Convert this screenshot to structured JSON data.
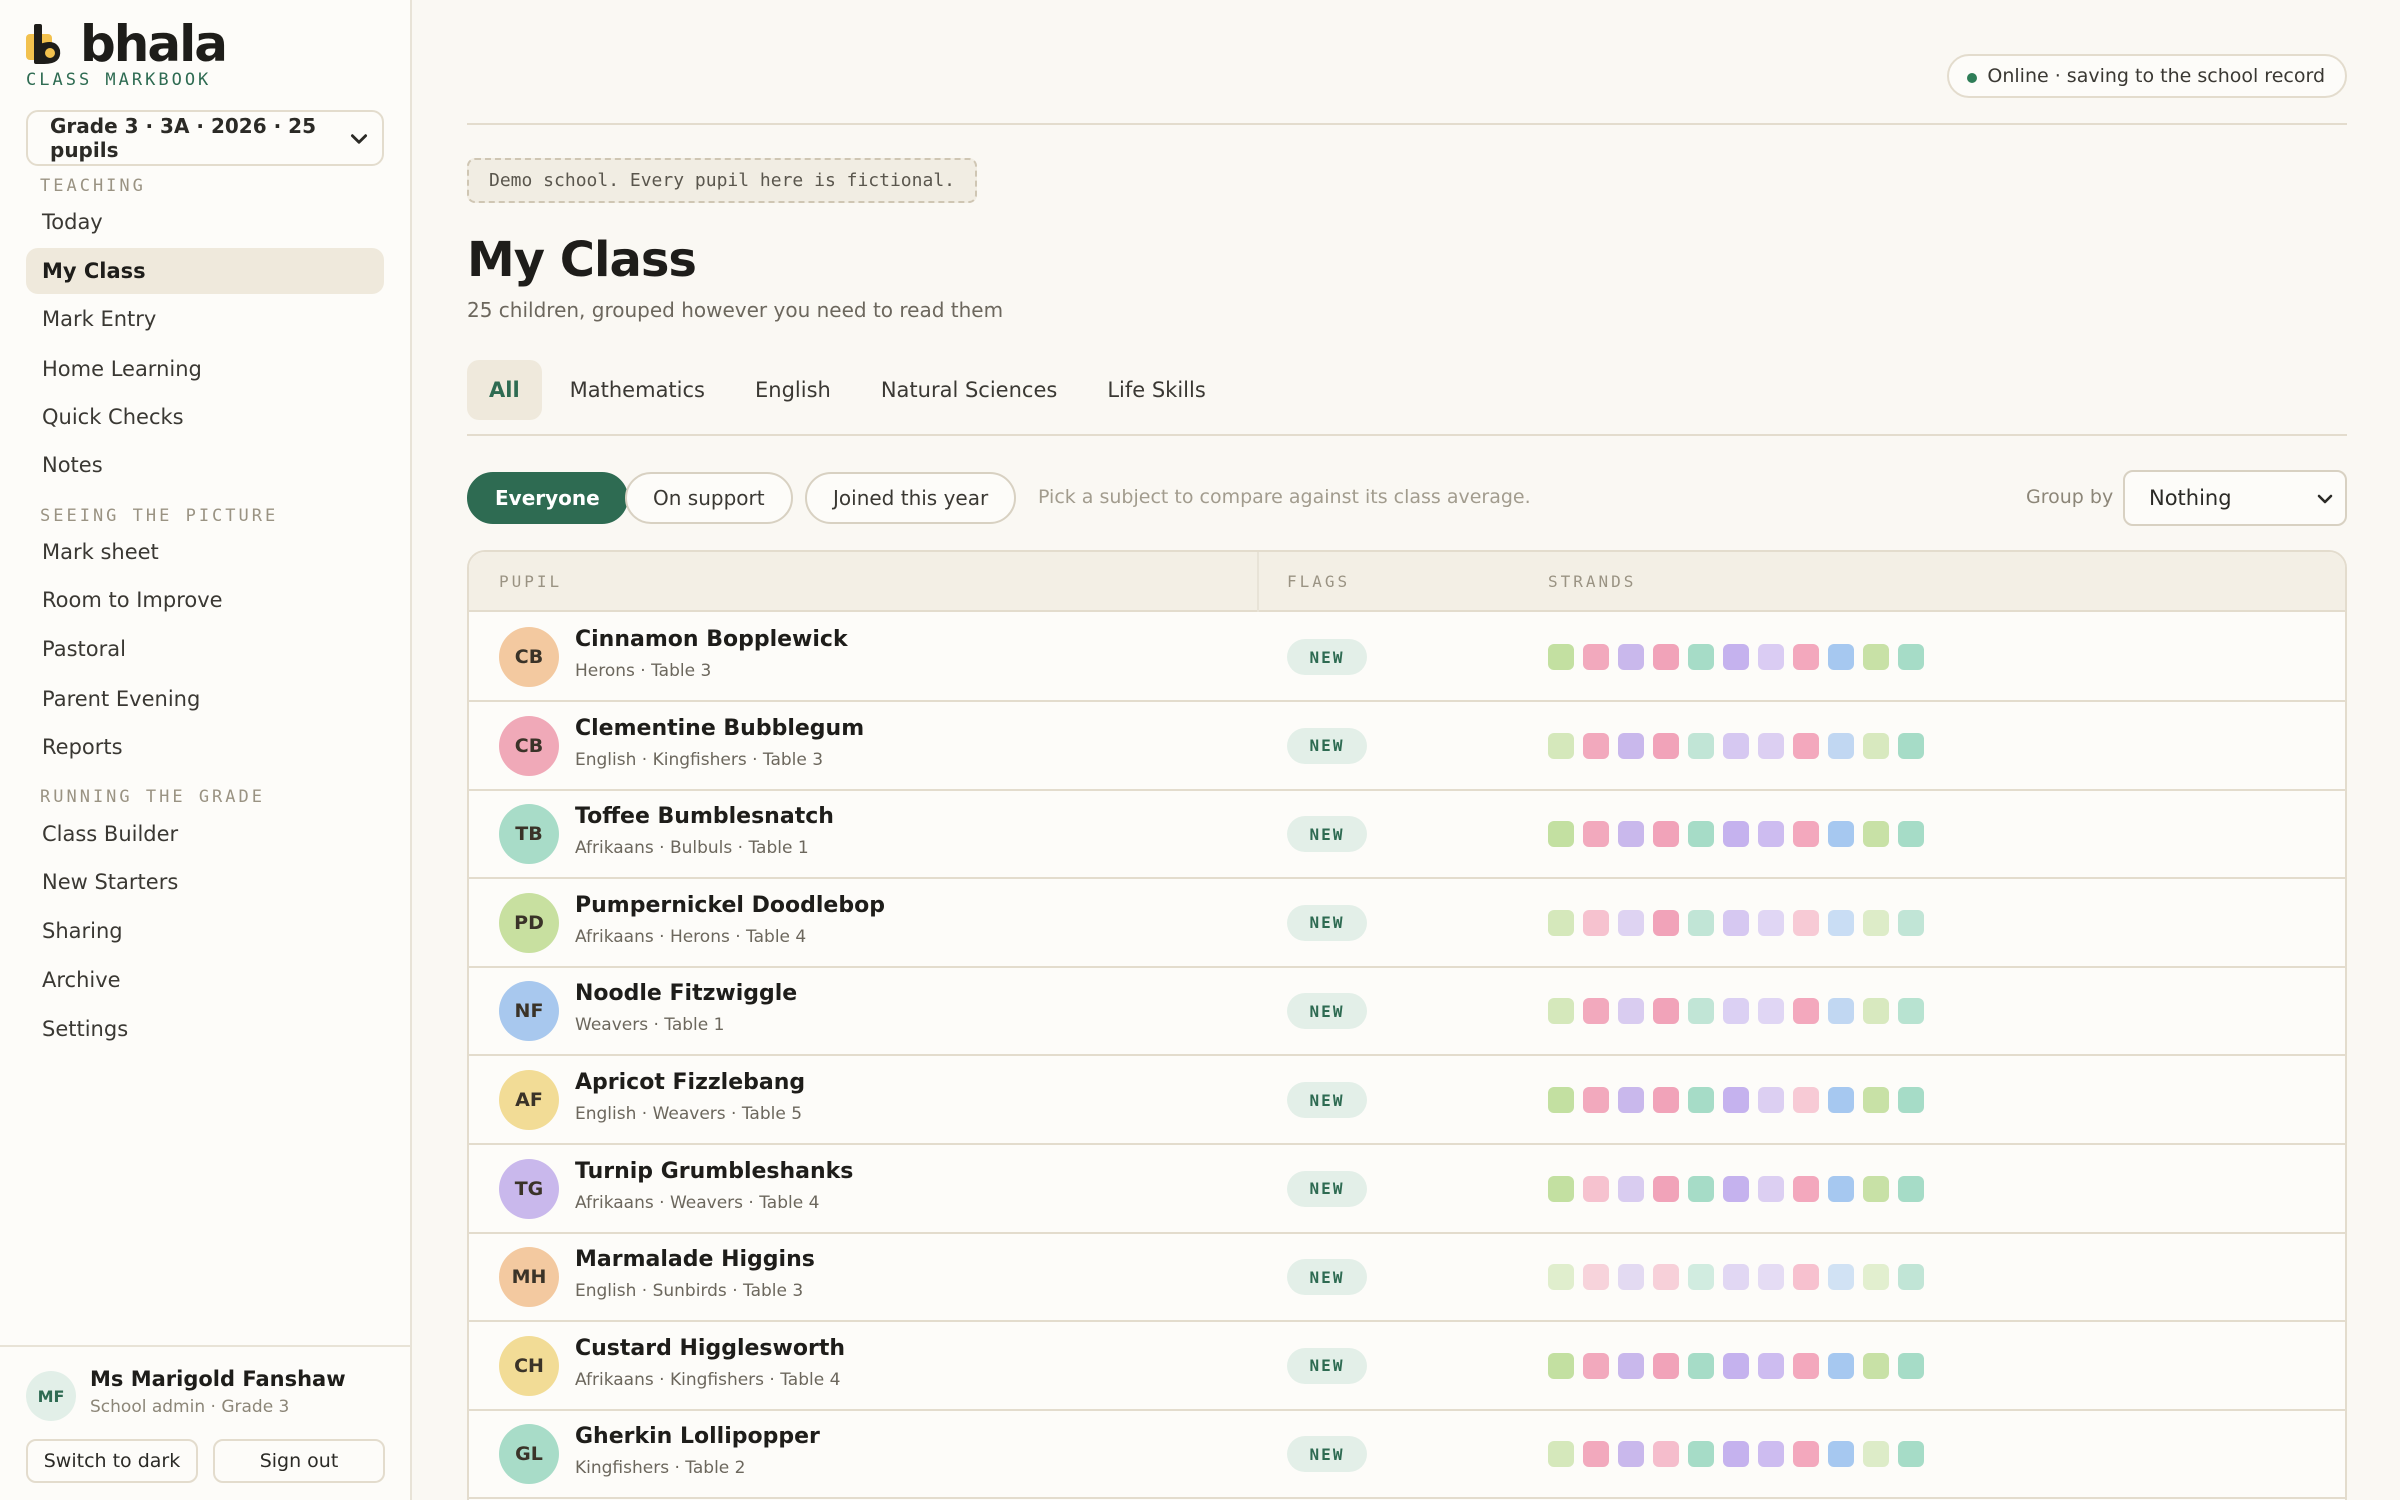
{
  "app": {
    "logo_text": "bhala",
    "subtitle": "CLASS MARKBOOK",
    "class_selector": "Grade 3 · 3A · 2026 · 25 pupils"
  },
  "sidebar": {
    "sections": [
      {
        "title": "TEACHING",
        "items": [
          "Today",
          "My Class",
          "Mark Entry",
          "Home Learning",
          "Quick Checks",
          "Notes"
        ]
      },
      {
        "title": "SEEING THE PICTURE",
        "items": [
          "Mark sheet",
          "Room to Improve",
          "Pastoral",
          "Parent Evening",
          "Reports"
        ]
      },
      {
        "title": "RUNNING THE GRADE",
        "items": [
          "Class Builder",
          "New Starters",
          "Sharing",
          "Archive",
          "Settings"
        ]
      }
    ],
    "active_item": "My Class",
    "user": {
      "initials": "MF",
      "name": "Ms Marigold Fanshaw",
      "role": "School admin · Grade 3"
    },
    "switch_theme_label": "Switch to dark",
    "sign_out_label": "Sign out"
  },
  "header": {
    "status": "Online · saving to the school record",
    "status_color": "#2e7d57",
    "demo_banner": "Demo school. Every pupil here is fictional.",
    "title": "My Class",
    "subtitle": "25 children, grouped however you need to read them"
  },
  "tabs": [
    "All",
    "Mathematics",
    "English",
    "Natural Sciences",
    "Life Skills"
  ],
  "active_tab": "All",
  "filters": {
    "chips": [
      "Everyone",
      "On support",
      "Joined this year"
    ],
    "active_chip": "Everyone",
    "hint": "Pick a subject to compare against its class average.",
    "group_by_label": "Group by",
    "group_by_value": "Nothing"
  },
  "table": {
    "columns": [
      "PUPIL",
      "FLAGS",
      "STRANDS"
    ],
    "rows": [
      {
        "initials": "CB",
        "name": "Cinnamon Bopplewick",
        "meta": "Herons · Table 3",
        "flag": "NEW",
        "avatar_color": "#f3c9a0",
        "strand_opacity": [
          1,
          1,
          1,
          1,
          1,
          1,
          0.75,
          1,
          1,
          1,
          1
        ]
      },
      {
        "initials": "CB",
        "name": "Clementine Bubblegum",
        "meta": "English · Kingfishers · Table 3",
        "flag": "NEW",
        "avatar_color": "#f0a9b8",
        "strand_opacity": [
          0.7,
          1,
          1,
          1,
          0.7,
          0.7,
          0.7,
          1,
          0.7,
          0.7,
          1
        ]
      },
      {
        "initials": "TB",
        "name": "Toffee Bumblesnatch",
        "meta": "Afrikaans · Bulbuls · Table 1",
        "flag": "NEW",
        "avatar_color": "#a8dcc8",
        "strand_opacity": [
          1,
          1,
          1,
          1,
          1,
          1,
          1,
          1,
          1,
          1,
          1
        ]
      },
      {
        "initials": "PD",
        "name": "Pumpernickel Doodlebop",
        "meta": "Afrikaans · Herons · Table 4",
        "flag": "NEW",
        "avatar_color": "#c8e0a0",
        "strand_opacity": [
          0.7,
          0.7,
          0.6,
          1,
          0.7,
          0.7,
          0.6,
          0.6,
          0.6,
          0.6,
          0.7
        ]
      },
      {
        "initials": "NF",
        "name": "Noodle Fitzwiggle",
        "meta": "Weavers · Table 1",
        "flag": "NEW",
        "avatar_color": "#a8c8ee",
        "strand_opacity": [
          0.7,
          1,
          0.7,
          1,
          0.7,
          0.6,
          0.6,
          1,
          0.7,
          0.7,
          0.8
        ]
      },
      {
        "initials": "AF",
        "name": "Apricot Fizzlebang",
        "meta": "English · Weavers · Table 5",
        "flag": "NEW",
        "avatar_color": "#f2dc96",
        "strand_opacity": [
          1,
          1,
          1,
          1,
          1,
          1,
          0.7,
          0.6,
          1,
          1,
          1
        ]
      },
      {
        "initials": "TG",
        "name": "Turnip Grumbleshanks",
        "meta": "Afrikaans · Weavers · Table 4",
        "flag": "NEW",
        "avatar_color": "#c9b8ec",
        "strand_opacity": [
          1,
          0.7,
          0.7,
          1,
          1,
          1,
          0.7,
          1,
          1,
          1,
          1
        ]
      },
      {
        "initials": "MH",
        "name": "Marmalade Higgins",
        "meta": "English · Sunbirds · Table 3",
        "flag": "NEW",
        "avatar_color": "#f3c9a0",
        "strand_opacity": [
          0.5,
          0.5,
          0.5,
          0.5,
          0.5,
          0.5,
          0.5,
          0.7,
          0.5,
          0.5,
          0.7
        ]
      },
      {
        "initials": "CH",
        "name": "Custard Higglesworth",
        "meta": "Afrikaans · Kingfishers · Table 4",
        "flag": "NEW",
        "avatar_color": "#f2dc96",
        "strand_opacity": [
          1,
          1,
          1,
          1,
          1,
          1,
          1,
          1,
          1,
          1,
          1
        ]
      },
      {
        "initials": "GL",
        "name": "Gherkin Lollipopper",
        "meta": "Kingfishers · Table 2",
        "flag": "NEW",
        "avatar_color": "#a8dcc8",
        "strand_opacity": [
          0.7,
          1,
          1,
          0.7,
          1,
          1,
          1,
          1,
          1,
          0.6,
          1
        ]
      }
    ],
    "strand_colors": [
      "#c3e0a1",
      "#f2a9bd",
      "#c9b8ec",
      "#f1a3b9",
      "#a6dcc7",
      "#c5b2ee",
      "#cdbcf0",
      "#f3a8bd",
      "#a6c8f0",
      "#c8e1a6",
      "#a6dcc7"
    ]
  }
}
